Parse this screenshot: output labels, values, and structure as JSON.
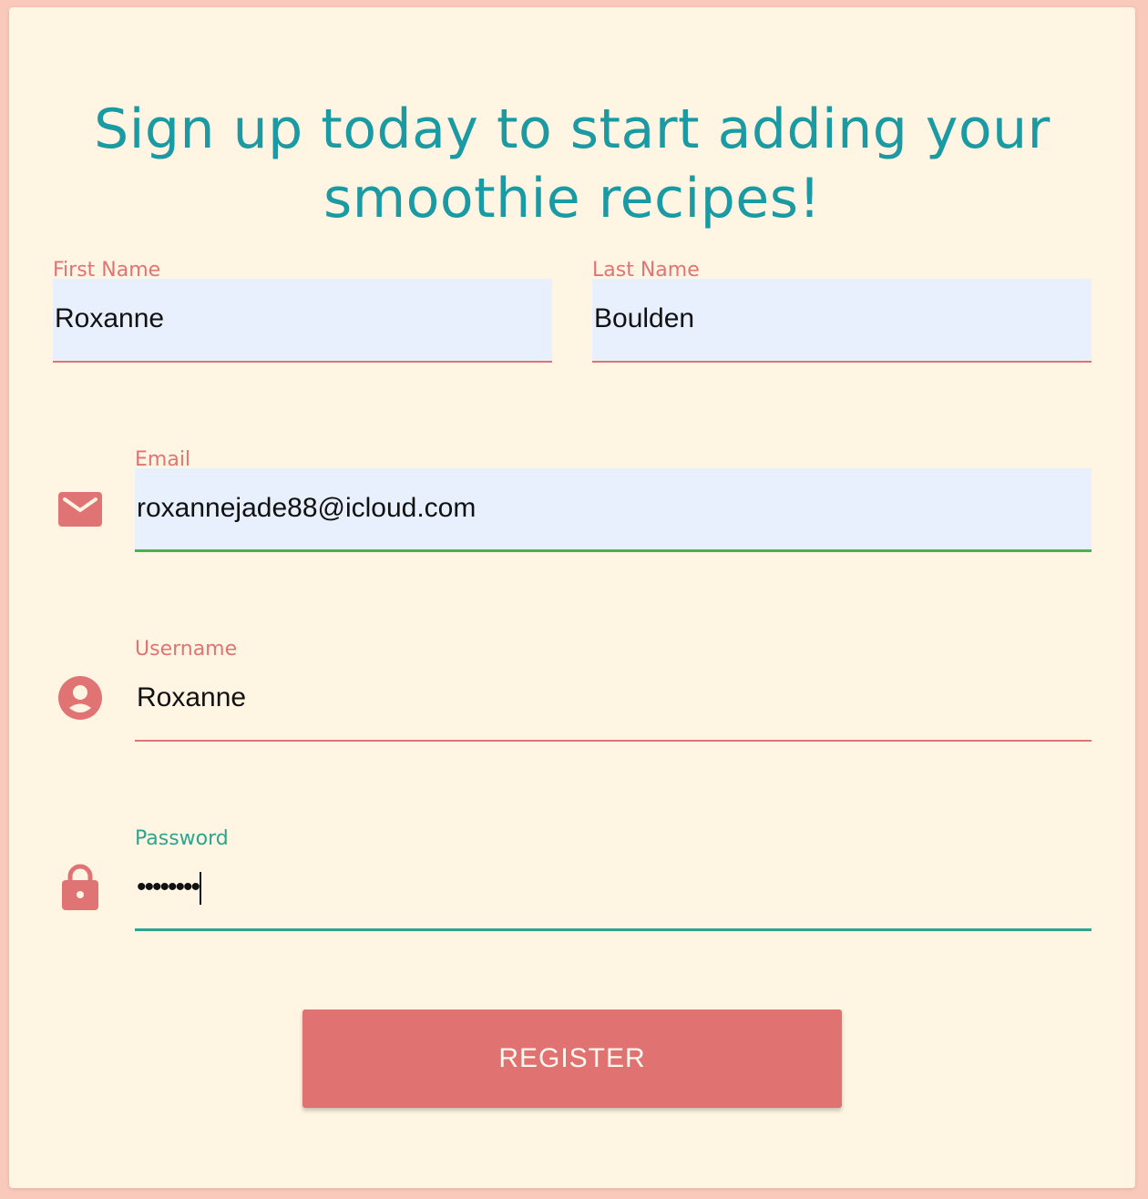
{
  "page": {
    "heading": "Sign up today to start adding your smoothie recipes!"
  },
  "form": {
    "first_name": {
      "label": "First Name",
      "value": "Roxanne"
    },
    "last_name": {
      "label": "Last Name",
      "value": "Boulden"
    },
    "email": {
      "label": "Email",
      "value": "roxannejade88@icloud.com",
      "icon": "envelope-icon"
    },
    "username": {
      "label": "Username",
      "value": "Roxanne",
      "icon": "account-circle-icon"
    },
    "password": {
      "label": "Password",
      "value": "••••••••",
      "icon": "lock-icon"
    },
    "register_label": "REGISTER"
  },
  "colors": {
    "background": "#f9c9bc",
    "card": "#fff5e2",
    "heading": "#1a9aa2",
    "accent": "#e07474",
    "focus_teal": "#2ba58f",
    "valid_green": "#4caf50",
    "autofill": "#e8f0fe"
  }
}
